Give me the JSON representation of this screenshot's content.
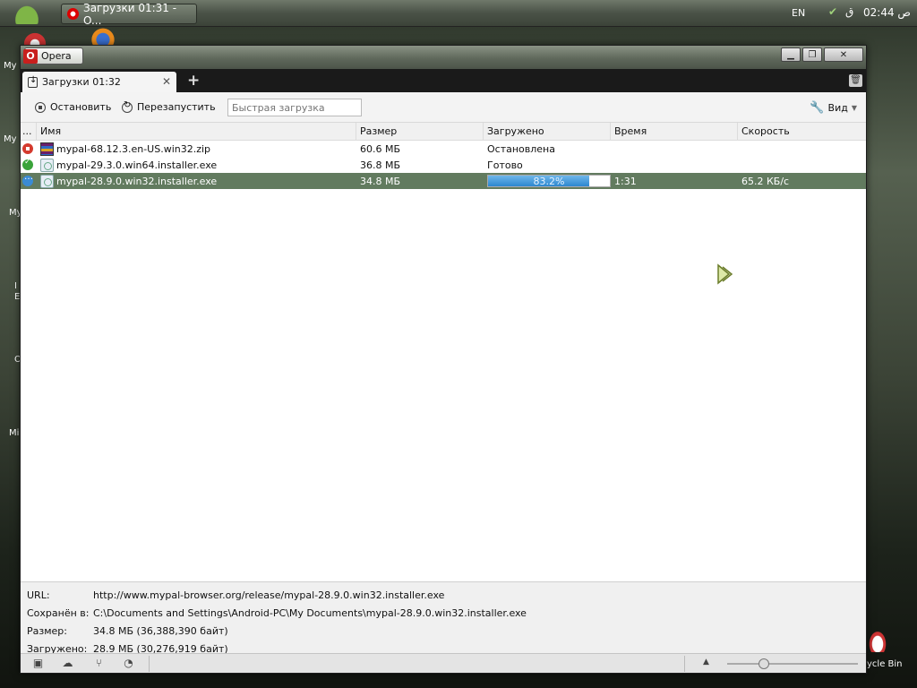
{
  "taskbar": {
    "task_title": "Загрузки 01:31 - O...",
    "lang": "EN",
    "clock": "02:44 ص"
  },
  "desktop": {
    "labels": [
      "My",
      "My",
      "My",
      "I\nE",
      "O",
      "Mi"
    ],
    "recycle_label": "ycle Bin"
  },
  "window": {
    "menu_label": "Opera",
    "tab_title": "Загрузки 01:32"
  },
  "toolbar": {
    "stop_label": "Остановить",
    "restart_label": "Перезапустить",
    "quick_placeholder": "Быстрая загрузка",
    "view_label": "Вид"
  },
  "columns": {
    "dots": "...",
    "name": "Имя",
    "size": "Размер",
    "loaded": "Загружено",
    "time": "Время",
    "speed": "Скорость"
  },
  "downloads": [
    {
      "status": "stopped",
      "icon": "zip-icon",
      "name": "mypal-68.12.3.en-US.win32.zip",
      "size": "60.6 МБ",
      "loaded": "Остановлена",
      "time": "",
      "speed": ""
    },
    {
      "status": "done",
      "icon": "exe-icon",
      "name": "mypal-29.3.0.win64.installer.exe",
      "size": "36.8 МБ",
      "loaded": "Готово",
      "time": "",
      "speed": ""
    },
    {
      "status": "active",
      "icon": "exe-icon",
      "name": "mypal-28.9.0.win32.installer.exe",
      "size": "34.8 МБ",
      "progress_percent": 83.2,
      "progress_text": "83.2%",
      "time": "1:31",
      "speed": "65.2 КБ/с"
    }
  ],
  "details": {
    "url_label": "URL:",
    "url_value": "http://www.mypal-browser.org/release/mypal-28.9.0.win32.installer.exe",
    "saved_label": "Сохранён в:",
    "saved_value": "C:\\Documents and Settings\\Android-PC\\My Documents\\mypal-28.9.0.win32.installer.exe",
    "size_label": "Размер:",
    "size_value": "34.8 МБ (36,388,390 байт)",
    "loaded_label": "Загружено:",
    "loaded_value": "28.9 МБ (30,276,919 байт)"
  },
  "colors": {
    "selected_row": "#627b5f",
    "progress": "#2c87cf",
    "stopped": "#d43a2e",
    "done": "#3aa33a",
    "active": "#3a8bd4"
  }
}
